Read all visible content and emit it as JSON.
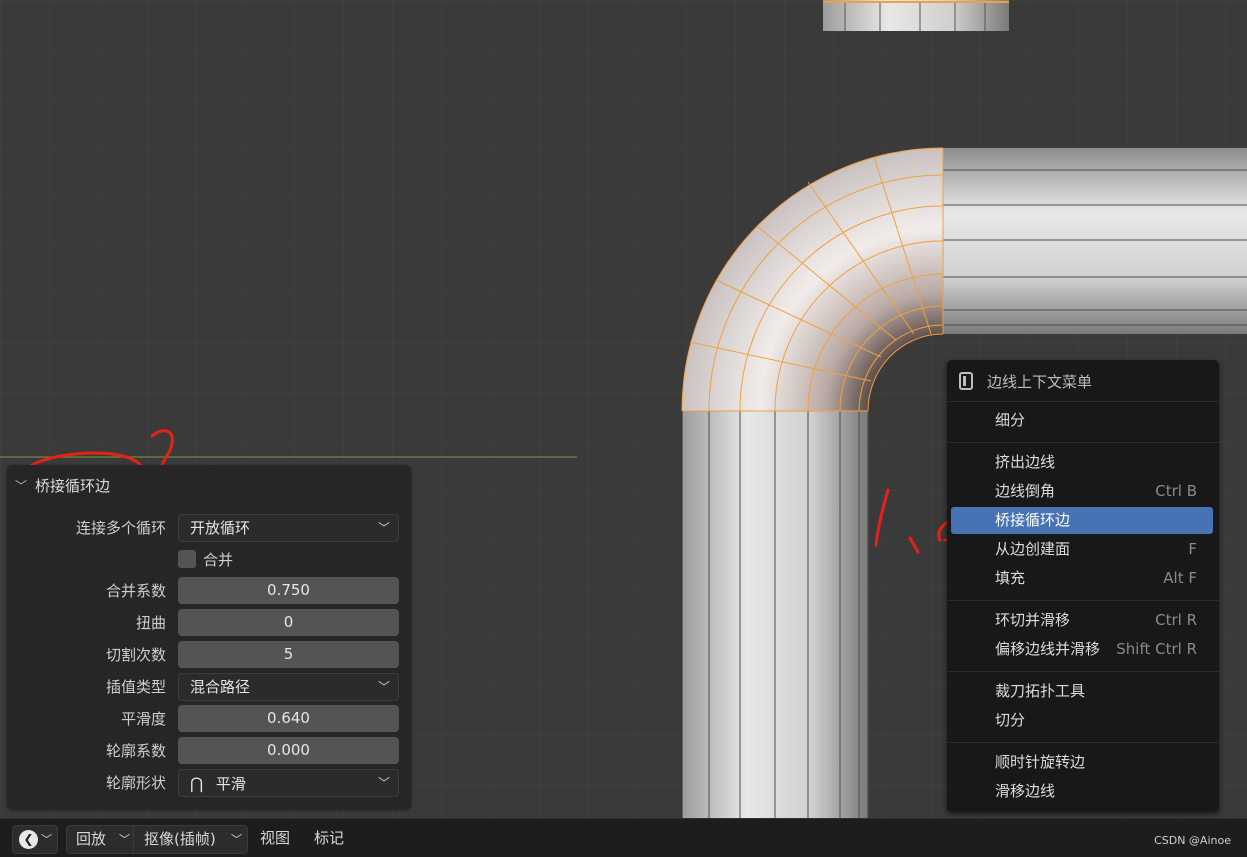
{
  "operator_panel": {
    "title": "桥接循环边",
    "connect_loops": {
      "label": "连接多个循环",
      "value": "开放循环"
    },
    "merge": {
      "label": "合并"
    },
    "merge_factor": {
      "label": "合并系数",
      "value": "0.750"
    },
    "twist": {
      "label": "扭曲",
      "value": "0"
    },
    "cuts": {
      "label": "切割次数",
      "value": "5"
    },
    "interpolation": {
      "label": "插值类型",
      "value": "混合路径"
    },
    "smoothness": {
      "label": "平滑度",
      "value": "0.640"
    },
    "profile_factor": {
      "label": "轮廓系数",
      "value": "0.000"
    },
    "profile_shape": {
      "label": "轮廓形状",
      "value": "平滑"
    }
  },
  "context_menu": {
    "title": "边线上下文菜单",
    "items": [
      {
        "label": "细分",
        "shortcut": ""
      },
      {
        "label": "挤出边线",
        "shortcut": ""
      },
      {
        "label": "边线倒角",
        "shortcut": "Ctrl B"
      },
      {
        "label": "桥接循环边",
        "shortcut": "",
        "active": true
      },
      {
        "label": "从边创建面",
        "shortcut": "F"
      },
      {
        "label": "填充",
        "shortcut": "Alt F"
      },
      {
        "label": "环切并滑移",
        "shortcut": "Ctrl R"
      },
      {
        "label": "偏移边线并滑移",
        "shortcut": "Shift Ctrl R"
      },
      {
        "label": "裁刀拓扑工具",
        "shortcut": ""
      },
      {
        "label": "切分",
        "shortcut": ""
      },
      {
        "label": "顺时针旋转边",
        "shortcut": ""
      },
      {
        "label": "滑移边线",
        "shortcut": ""
      }
    ]
  },
  "timeline": {
    "playback": "回放",
    "keying": "抠像(插帧)",
    "view": "视图",
    "marker": "标记"
  },
  "annotations": {
    "one": "1、",
    "two": "2、",
    "three": "3、"
  },
  "watermark": "CSDN @Ainoe",
  "colors": {
    "viewport_bg": "#3a3a3a",
    "selection_orange": "#f0a040",
    "menu_highlight": "#4772b3",
    "annotation_red": "#e8201a"
  }
}
